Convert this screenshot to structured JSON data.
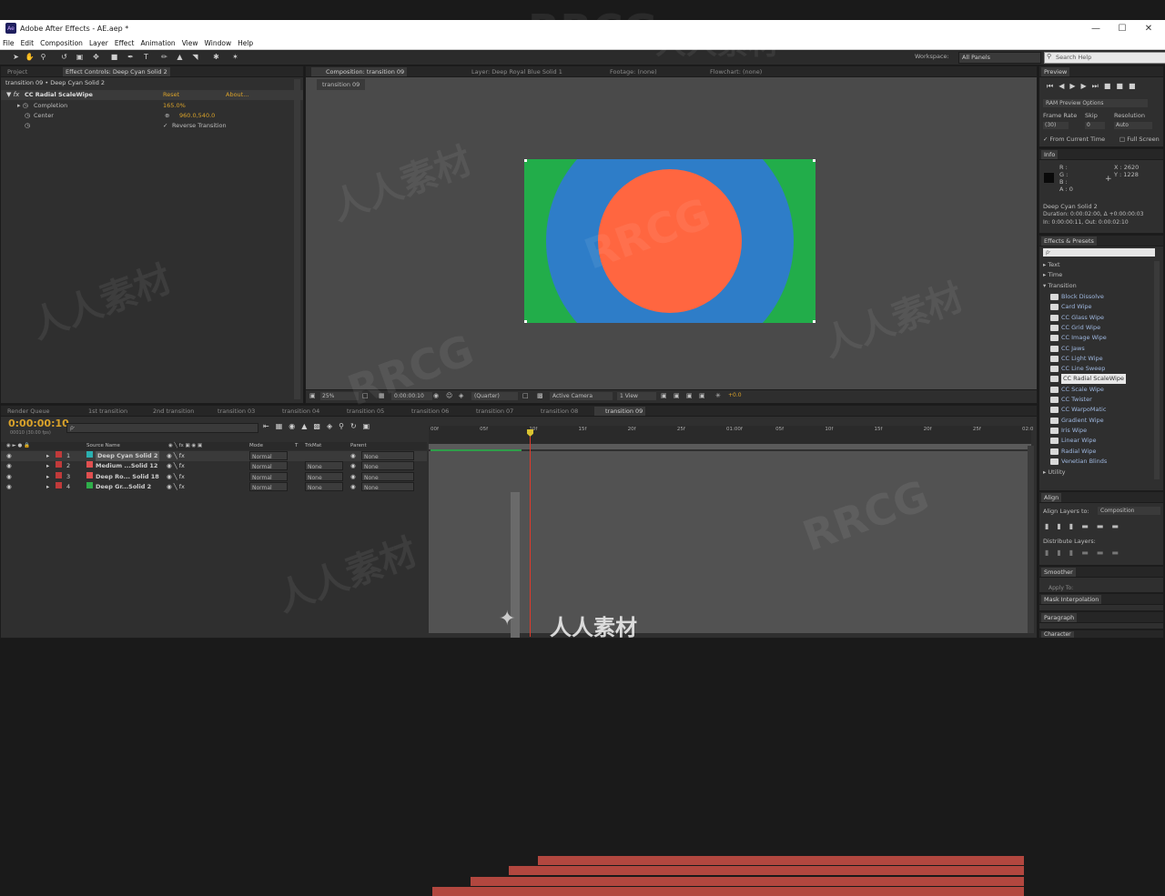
{
  "window": {
    "title": "Adobe After Effects - AE.aep *",
    "app_icon_text": "Ae"
  },
  "menu": [
    "File",
    "Edit",
    "Composition",
    "Layer",
    "Effect",
    "Animation",
    "View",
    "Window",
    "Help"
  ],
  "toolbar": {
    "workspace_label": "Workspace:",
    "workspace_value": "All Panels",
    "search_placeholder": "Search Help"
  },
  "left_panel": {
    "tabs": [
      "Project",
      "Effect Controls: Deep Cyan Solid 2"
    ],
    "breadcrumb": "transition 09 • Deep Cyan Solid 2",
    "effect": {
      "name": "CC Radial ScaleWipe",
      "reset": "Reset",
      "about": "About..."
    },
    "properties": [
      {
        "label": "Completion",
        "value": "165.0%"
      },
      {
        "label": "Center",
        "value": "960.0,540.0"
      }
    ],
    "checkbox": "Reverse Transition"
  },
  "viewer": {
    "tabs": [
      "Composition: transition 09",
      "Layer: Deep Royal Blue Solid 1",
      "Footage: (none)",
      "Flowchart: (none)"
    ],
    "subtab": "transition 09",
    "colors": {
      "green": "#22ad4a",
      "blue": "#2e7dc8",
      "orange": "#ff6640"
    },
    "bottom": {
      "zoom": "25%",
      "timecode": "0:00:00:10",
      "resolution": "(Quarter)",
      "camera": "Active Camera",
      "views": "1 View",
      "exposure": "+0.0"
    }
  },
  "right_panels": {
    "preview": {
      "title": "Preview",
      "ram_options": "RAM Preview Options",
      "frame_rate_label": "Frame Rate",
      "skip_label": "Skip",
      "resolution_label": "Resolution",
      "frame_rate": "(30)",
      "skip": "0",
      "resolution": "Auto",
      "from_current": "From Current Time",
      "full_screen": "Full Screen"
    },
    "info": {
      "title": "Info",
      "channels": [
        "R :",
        "G :",
        "B :",
        "A : 0"
      ],
      "coords": [
        "X : 2620",
        "Y : 1228"
      ],
      "lines": [
        "Deep Cyan Solid 2",
        "Duration: 0:00:02:00, Δ +0:00:00:03",
        "In: 0:00:00:11, Out: 0:00:02:10"
      ]
    },
    "effects_presets": {
      "title": "Effects & Presets",
      "search_placeholder": "ρ·",
      "categories_top": [
        "Text",
        "Time",
        "Transition"
      ],
      "items": [
        "Block Dissolve",
        "Card Wipe",
        "CC Glass Wipe",
        "CC Grid Wipe",
        "CC Image Wipe",
        "CC Jaws",
        "CC Light Wipe",
        "CC Line Sweep",
        "CC Radial ScaleWipe",
        "CC Scale Wipe",
        "CC Twister",
        "CC WarpoMatic",
        "Gradient Wipe",
        "Iris Wipe",
        "Linear Wipe",
        "Radial Wipe",
        "Venetian Blinds"
      ],
      "selected": "CC Radial ScaleWipe",
      "category_bottom": "Utility"
    },
    "align": {
      "title": "Align",
      "align_to_label": "Align Layers to:",
      "align_to_value": "Composition",
      "distribute_label": "Distribute Layers:"
    },
    "smoother": {
      "title": "Smoother",
      "apply_label": "Apply To:"
    },
    "mask_interpolation": {
      "title": "Mask Interpolation"
    },
    "paragraph": {
      "title": "Paragraph"
    },
    "character": {
      "title": "Character"
    }
  },
  "timeline": {
    "tabs": [
      "Render Queue",
      "1st transition",
      "2nd transition",
      "transition 03",
      "transition 04",
      "transition 05",
      "transition 06",
      "transition 07",
      "transition 08",
      "transition 09"
    ],
    "timecode": "0:00:00:10",
    "fps_info": "00010 (30.00 fps)",
    "search_placeholder": "ρ·",
    "columns": {
      "source_name": "Source Name",
      "mode": "Mode",
      "t": "T",
      "trkmat": "TrkMat",
      "parent": "Parent"
    },
    "layers": [
      {
        "num": "1",
        "name": "Deep Cyan Solid 2",
        "mode": "Normal",
        "trkmat": "",
        "parent": "None",
        "color": "#2bb0b0"
      },
      {
        "num": "2",
        "name": "Medium ...Solid 12",
        "mode": "Normal",
        "trkmat": "None",
        "parent": "None",
        "color": "#e05050"
      },
      {
        "num": "3",
        "name": "Deep Ro... Solid 18",
        "mode": "Normal",
        "trkmat": "None",
        "parent": "None",
        "color": "#e05050"
      },
      {
        "num": "4",
        "name": "Deep Gr...Solid 2",
        "mode": "Normal",
        "trkmat": "None",
        "parent": "None",
        "color": "#2fae4a"
      }
    ],
    "ruler": [
      "00f",
      "05f",
      "10f",
      "15f",
      "20f",
      "25f",
      "01:00f",
      "05f",
      "10f",
      "15f",
      "20f",
      "25f",
      "02:0"
    ]
  },
  "watermark": {
    "primary": "RRCG",
    "secondary": "人人素材"
  }
}
